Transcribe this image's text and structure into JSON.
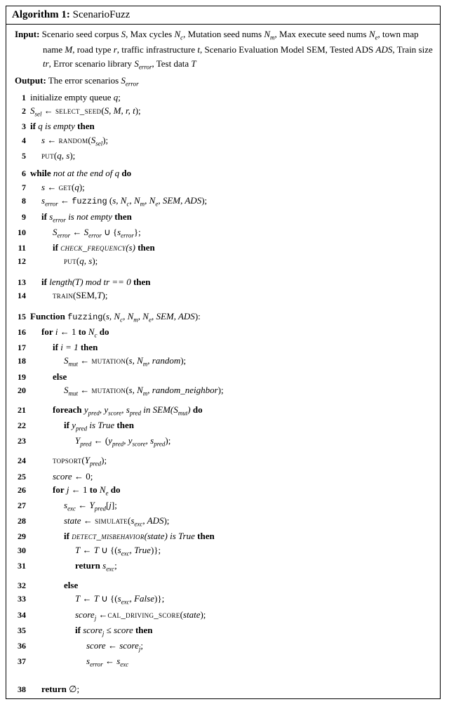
{
  "title_prefix": "Algorithm 1:",
  "title_name": "ScenarioFuzz",
  "input_label": "Input:",
  "input_text": "Scenario seed corpus S, Max cycles N_c, Mutation seed nums N_m, Max execute seed nums N_e, town map name M, road type r, traffic infrastructure t, Scenario Evaluation Model SEM, Tested ADS ADS, Train size tr, Error scenario library S_error, Test data T",
  "output_label": "Output:",
  "output_text": "The error scenarios S_error",
  "lines": {
    "l1": "initialize empty queue q;",
    "l2": "S_sel ← SELECT_SEED(S, M, r, t);",
    "l3": "if q is empty then",
    "l4": "s ← RANDOM(S_sel);",
    "l5": "PUT(q, s);",
    "l6": "while not at the end of q do",
    "l7": "s ← GET(q);",
    "l8": "s_error ← fuzzing (s, N_c, N_m, N_e, SEM, ADS);",
    "l9": "if s_error is not empty then",
    "l10": "S_error ← S_error ∪ {s_error};",
    "l11": "if CHECK_FREQUENCY(s) then",
    "l12": "PUT(q, s);",
    "l13": "if length(T) mod tr == 0 then",
    "l14": "TRAIN(SEM,T);",
    "l15": "Function fuzzing(s, N_c, N_m, N_e, SEM, ADS):",
    "l16": "for i ← 1 to N_c do",
    "l17": "if i = 1 then",
    "l18": "S_mut ← MUTATION(s, N_m, random);",
    "l19": "else",
    "l20": "S_mut ← MUTATION(s, N_m, random_neighbor);",
    "l21": "foreach y_pred, y_score, s_pred in SEM(S_mut) do",
    "l22": "if y_pred is True then",
    "l23": "Y_pred ← (y_pred, y_score, s_pred);",
    "l24": "TOPSORT(Y_pred);",
    "l25": "score ← 0;",
    "l26": "for j ← 1 to N_e do",
    "l27": "s_exc ← Y_pred[j];",
    "l28": "state ← SIMULATE(s_exc, ADS);",
    "l29": "if DETECT_MISBEHAVIOR(state) is True then",
    "l30": "T ← T ∪ {(s_exc, True)};",
    "l31": "return s_exc;",
    "l32": "else",
    "l33": "T ← T ∪ {(s_exc, False)};",
    "l34": "score_j ← CAL_DRIVING_SCORE(state);",
    "l35": "if score_j ≤ score then",
    "l36": "score ← score_j;",
    "l37": "s_error ← s_exc",
    "l38": "return ∅;"
  }
}
